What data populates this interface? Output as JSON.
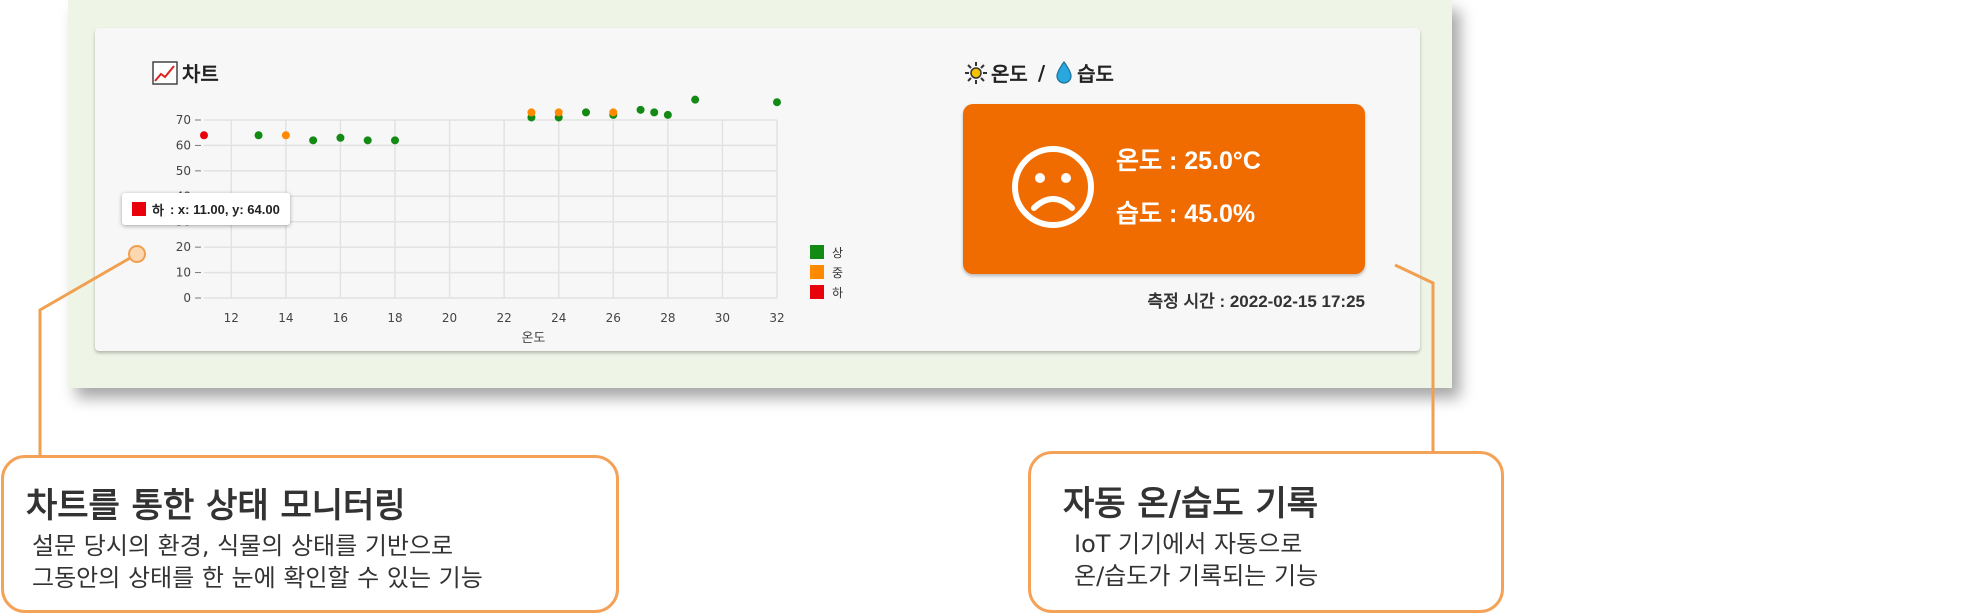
{
  "chart_section": {
    "title": "차트"
  },
  "temp_section": {
    "title_temp": "온도",
    "separator": "/",
    "title_hum": "습도"
  },
  "status": {
    "temperature_text": "온도 : 25.0°C",
    "humidity_text": "습도 : 45.0%",
    "face": "sad-face-icon",
    "box_color": "#f06c00"
  },
  "measure_time": "측정 시간 : 2022-02-15 17:25",
  "tooltip": {
    "series": "하",
    "text": ": x: 11.00, y: 64.00"
  },
  "callouts": {
    "left": {
      "title": "차트를 통한 상태 모니터링",
      "line1": "설문 당시의 환경, 식물의 상태를 기반으로",
      "line2": "그동안의 상태를 한 눈에 확인할 수 있는 기능"
    },
    "right": {
      "title": "자동 온/습도 기록",
      "line1": "IoT 기기에서 자동으로",
      "line2": "온/습도가 기록되는 기능"
    }
  },
  "chart_data": {
    "type": "scatter",
    "xlabel": "온도",
    "ylabel": "",
    "xlim": [
      11,
      32
    ],
    "ylim": [
      0,
      70
    ],
    "xticks": [
      12,
      14,
      16,
      18,
      20,
      22,
      24,
      26,
      28,
      30,
      32
    ],
    "yticks": [
      0,
      10,
      20,
      30,
      40,
      50,
      60,
      70
    ],
    "legend_position": "right",
    "series": [
      {
        "name": "상",
        "color": "#138a13",
        "points": [
          [
            13,
            64
          ],
          [
            15,
            62
          ],
          [
            16,
            63
          ],
          [
            17,
            62
          ],
          [
            18,
            62
          ],
          [
            23,
            71
          ],
          [
            24,
            71
          ],
          [
            25,
            73
          ],
          [
            26,
            72
          ],
          [
            27,
            74
          ],
          [
            27.5,
            73
          ],
          [
            28,
            72
          ],
          [
            29,
            78
          ],
          [
            32,
            77
          ]
        ]
      },
      {
        "name": "중",
        "color": "#ff8a00",
        "points": [
          [
            14,
            64
          ],
          [
            23,
            73
          ],
          [
            24,
            73
          ],
          [
            26,
            73
          ]
        ]
      },
      {
        "name": "하",
        "color": "#e8000b",
        "points": [
          [
            11,
            64
          ]
        ]
      }
    ]
  }
}
